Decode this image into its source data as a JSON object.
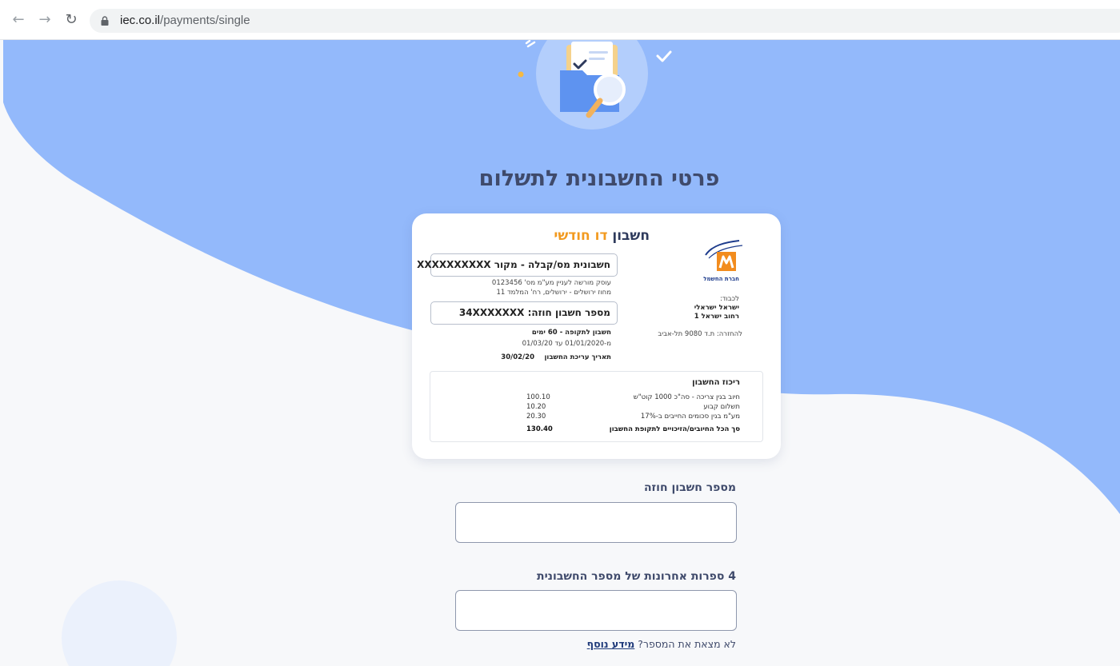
{
  "browser": {
    "url_host": "iec.co.il",
    "url_path": "/payments/single"
  },
  "page": {
    "title": "פרטי החשבונית לתשלום"
  },
  "bill": {
    "heading_main": "חשבון",
    "heading_accent": "דו חודשי",
    "logo_caption": "חברת החשמל",
    "invoice_box": "חשבונית מס/קבלה - מקור XXXXXXXXXX",
    "dealer_line": "עוסק מורשה לעניין מע\"מ מס' 0123456",
    "district_line": "מחוז ירושלים - ירושלים, רח' המלמד 11",
    "contract_box": "מספר חשבון חוזה: 34XXXXXXX",
    "period_title": "חשבון לתקופה - 60 ימים",
    "period_range": "מ-01/01/2020 עד 01/03/20",
    "issue_label": "תאריך עריכת החשבון",
    "issue_date": "30/02/20",
    "recipient_to": "לכבוד:",
    "recipient_name": "ישראל ישראלי",
    "recipient_street": "רחוב ישראל 1",
    "return_address": "להחזרה: ת.ד 9080 תל-אביב",
    "summary": {
      "title": "ריכוז החשבון",
      "rows": [
        {
          "label": "חיוב בגין צריכה - סה\"כ 1000 קוט\"ש",
          "value": "100.10"
        },
        {
          "label": "תשלום קבוע",
          "value": "10.20"
        },
        {
          "label": "מע\"מ בגין סכומים החייבים ב-17%",
          "value": "20.30"
        }
      ],
      "total_label": "סך הכל החיובים/הזיכויים לתקופת החשבון",
      "total_value": "130.40"
    }
  },
  "form": {
    "contract_label": "מספר חשבון חוזה",
    "contract_value": "",
    "invoice_digits_label": "4 ספרות אחרונות של מספר החשבונית",
    "invoice_digits_value": "",
    "help_text": "לא מצאת את המספר?",
    "help_link": "מידע נוסף"
  },
  "colors": {
    "wave_blue": "#93b9fb",
    "title": "#3f4a6b",
    "accent_orange": "#f29a1f",
    "logo_orange": "#f28c1e",
    "logo_blue": "#1e3c8c"
  }
}
